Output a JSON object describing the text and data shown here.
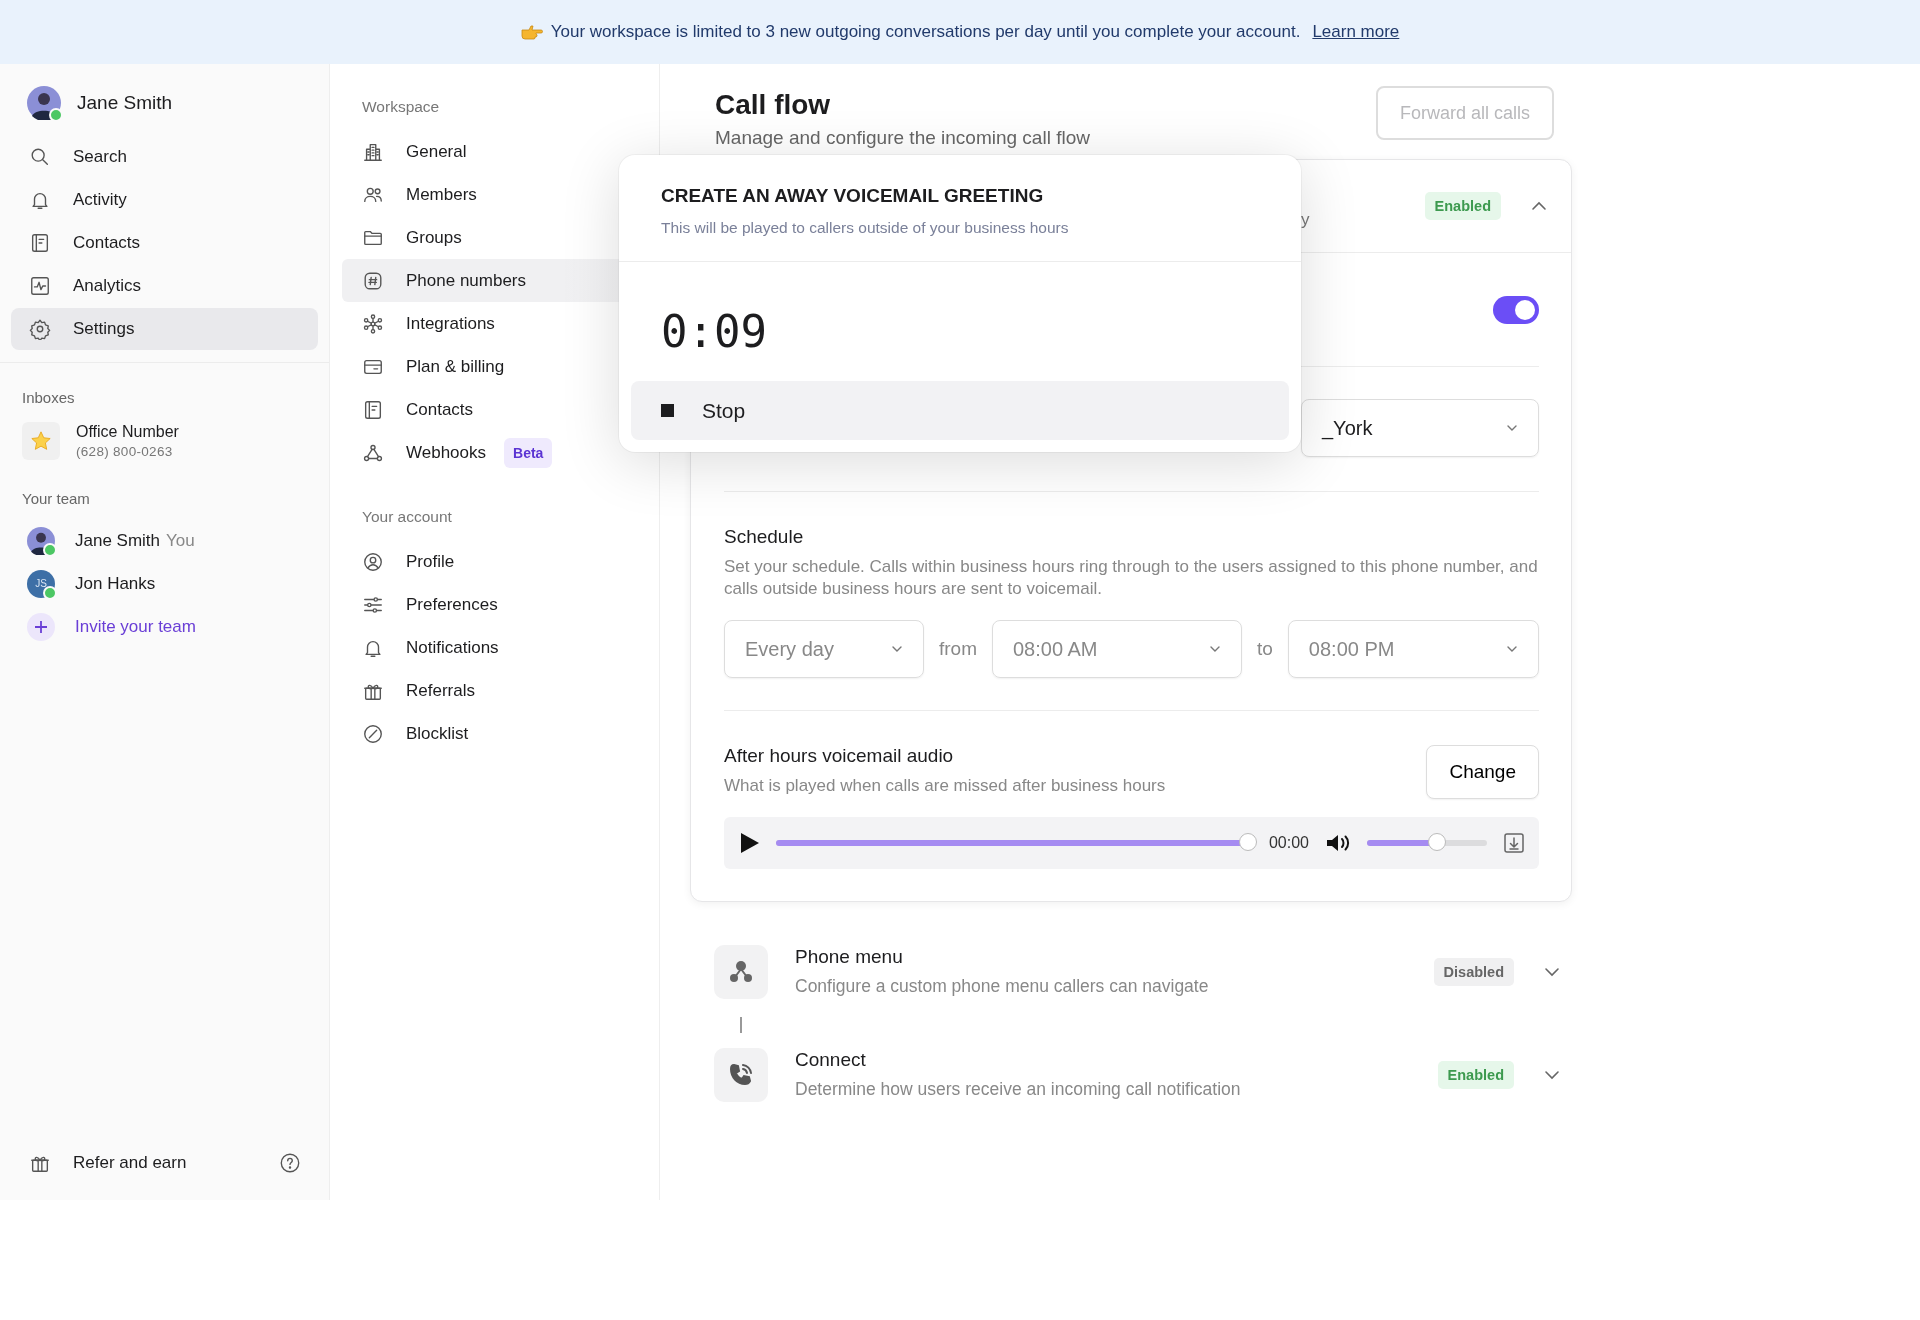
{
  "banner": {
    "text": "Your workspace is limited to 3 new outgoing conversations per day until you complete your account.",
    "link": "Learn more"
  },
  "user": {
    "name": "Jane Smith",
    "online": true
  },
  "nav": [
    {
      "label": "Search",
      "selected": false
    },
    {
      "label": "Activity",
      "selected": false
    },
    {
      "label": "Contacts",
      "selected": false
    },
    {
      "label": "Analytics",
      "selected": false
    },
    {
      "label": "Settings",
      "selected": true
    }
  ],
  "inboxes": {
    "heading": "Inboxes",
    "items": [
      {
        "name": "Office Number",
        "number": "(628) 800-0263"
      }
    ]
  },
  "team": {
    "heading": "Your team",
    "members": [
      {
        "name": "Jane Smith",
        "tag": "You",
        "online": true
      },
      {
        "name": "Jon Hanks",
        "initials": "JS",
        "online": true
      }
    ],
    "invite": "Invite your team"
  },
  "sidebar_footer": {
    "label": "Refer and earn"
  },
  "settings_nav": [
    {
      "heading": "Workspace",
      "items": [
        {
          "label": "General",
          "selected": false
        },
        {
          "label": "Members",
          "selected": false
        },
        {
          "label": "Groups",
          "selected": false
        },
        {
          "label": "Phone numbers",
          "selected": true
        },
        {
          "label": "Integrations",
          "selected": false
        },
        {
          "label": "Plan & billing",
          "selected": false
        },
        {
          "label": "Contacts",
          "selected": false
        },
        {
          "label": "Webhooks",
          "badge": "Beta",
          "selected": false
        }
      ]
    },
    {
      "heading": "Your account",
      "items": [
        {
          "label": "Profile",
          "selected": false
        },
        {
          "label": "Preferences",
          "selected": false
        },
        {
          "label": "Notifications",
          "selected": false
        },
        {
          "label": "Referrals",
          "selected": false
        },
        {
          "label": "Blocklist",
          "selected": false
        }
      ]
    }
  ],
  "page": {
    "title": "Call flow",
    "subtitle": "Manage and configure the incoming call flow",
    "action": {
      "label": "Forward all calls",
      "disabled": true
    }
  },
  "card": {
    "title_fragment": "y",
    "status": "Enabled",
    "enabled": true,
    "expanded": true,
    "toggle": {
      "on": true
    },
    "timezone": {
      "value": "_York"
    },
    "schedule": {
      "title": "Schedule",
      "description": "Set your schedule. Calls within business hours ring through to the users assigned to this phone number, and calls outside business hours are sent to voicemail.",
      "days": "Every day",
      "from_label": "from",
      "from": "08:00 AM",
      "to_label": "to",
      "to": "08:00 PM"
    },
    "after_hours": {
      "title": "After hours voicemail audio",
      "description": "What is played when calls are missed after business hours",
      "action": "Change",
      "player": {
        "time": "00:00",
        "progress": {
          "level": 0.99
        },
        "volume": {
          "level": 0.58
        }
      }
    }
  },
  "steps": [
    {
      "title": "Phone menu",
      "description": "Configure a custom phone menu callers can navigate",
      "status": "Disabled",
      "enabled": false,
      "expanded": false
    },
    {
      "title": "Connect",
      "description": "Determine how users receive an incoming call notification",
      "status": "Enabled",
      "enabled": true,
      "expanded": false
    }
  ],
  "dialog": {
    "title": "CREATE AN AWAY VOICEMAIL GREETING",
    "subtitle": "This will be played to callers outside of your business hours",
    "timer": "0:09",
    "action": "Stop"
  }
}
